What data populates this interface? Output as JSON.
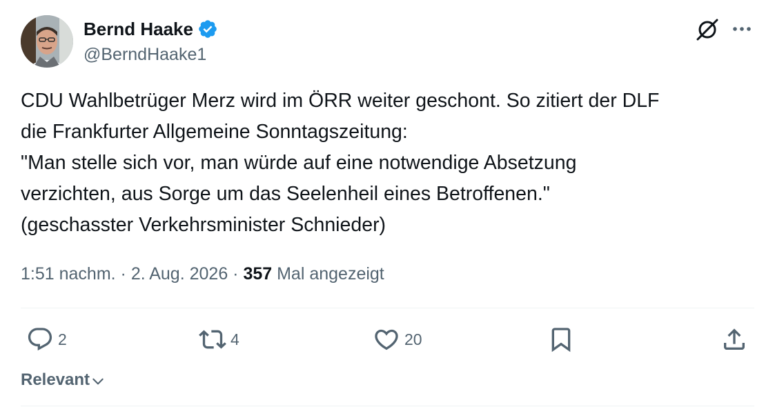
{
  "author": {
    "display_name": "Bernd Haake",
    "handle": "@BerndHaake1",
    "verified": true
  },
  "tweet": {
    "lines": [
      "CDU Wahlbetrüger Merz wird im ÖRR weiter geschont. So zitiert der DLF",
      "die Frankfurter Allgemeine Sonntagszeitung:",
      "\"Man stelle sich vor, man würde auf eine notwendige Absetzung",
      "verzichten, aus Sorge um das Seelenheil eines Betroffenen.\"",
      "(geschasster Verkehrsminister Schnieder)"
    ]
  },
  "meta": {
    "time": "1:51 nachm.",
    "separator1": " · ",
    "date": "2. Aug. 2026",
    "separator2": " · ",
    "views_count": "357",
    "views_label": " Mal angezeigt"
  },
  "actions": {
    "reply_count": "2",
    "retweet_count": "4",
    "like_count": "20"
  },
  "sort": {
    "label": "Relevant"
  },
  "icons": {
    "verified": "verified-badge-icon",
    "grok": "grok-icon",
    "more": "more-dots-icon",
    "reply": "reply-bubble-icon",
    "retweet": "retweet-arrows-icon",
    "like": "heart-icon",
    "bookmark": "bookmark-icon",
    "share": "share-upload-icon",
    "chevron": "chevron-down-icon"
  },
  "colors": {
    "text_primary": "#0f1419",
    "text_secondary": "#536471",
    "verified_blue": "#1d9bf0",
    "divider": "#eff3f4"
  }
}
